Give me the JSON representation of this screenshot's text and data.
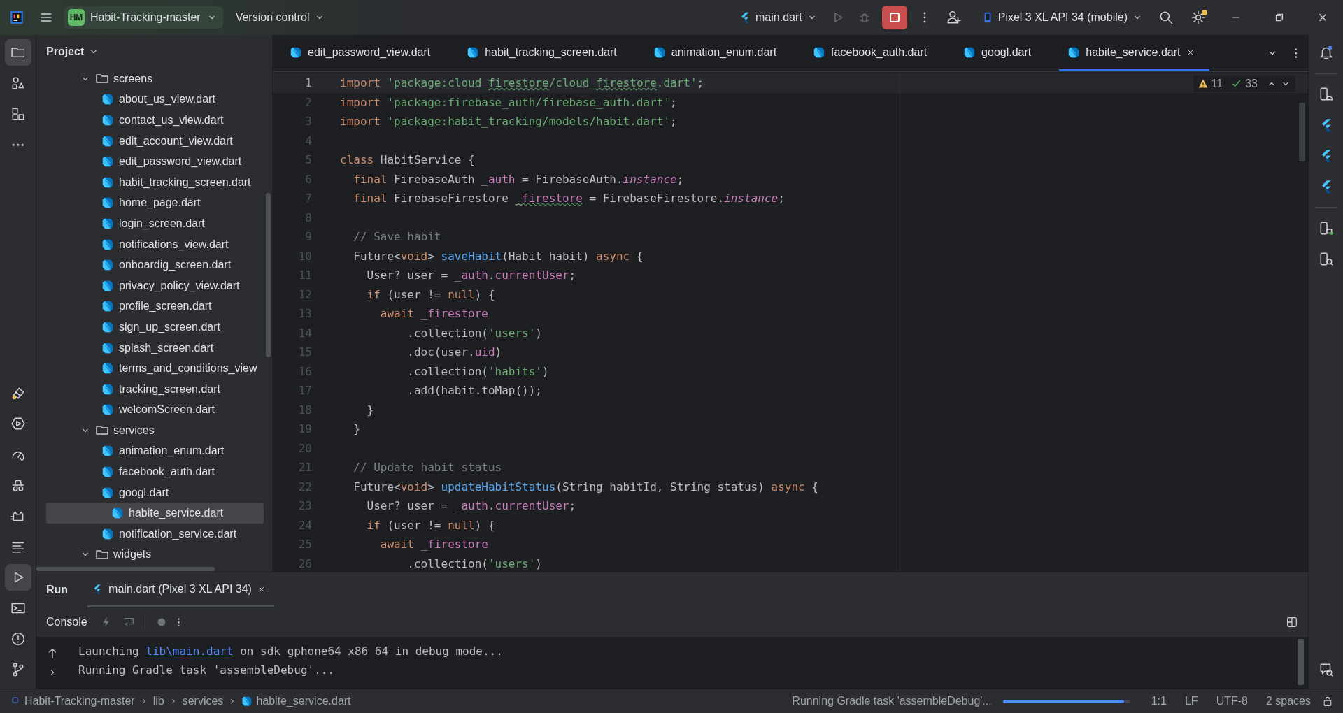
{
  "title_bar": {
    "project_badge": "HM",
    "project_name": "Habit-Tracking-master",
    "vcs_menu": "Version control",
    "run_config": "main.dart",
    "device": "Pixel 3 XL API 34 (mobile)",
    "run_enabled": false,
    "debug_enabled": false,
    "settings_notification": true
  },
  "left_toolbar": {
    "top": [
      {
        "selected": true
      },
      {
        "selected": false
      },
      {
        "selected": false
      },
      {
        "selected": false
      }
    ],
    "bottom": [
      {
        "selected": false
      },
      {
        "selected": false
      },
      {
        "selected": false
      },
      {
        "selected": false
      },
      {
        "selected": false
      },
      {
        "selected": false
      },
      {
        "selected": true
      },
      {
        "selected": false
      },
      {
        "selected": false
      },
      {
        "selected": false
      }
    ]
  },
  "project_panel": {
    "title": "Project",
    "tree": [
      {
        "name": "screens",
        "kind": "folder",
        "expanded": true,
        "selected": false,
        "children": [
          {
            "name": "about_us_view.dart",
            "kind": "file",
            "selected": false
          },
          {
            "name": "contact_us_view.dart",
            "kind": "file",
            "selected": false
          },
          {
            "name": "edit_account_view.dart",
            "kind": "file",
            "selected": false
          },
          {
            "name": "edit_password_view.dart",
            "kind": "file",
            "selected": false
          },
          {
            "name": "habit_tracking_screen.dart",
            "kind": "file",
            "selected": false
          },
          {
            "name": "home_page.dart",
            "kind": "file",
            "selected": false
          },
          {
            "name": "login_screen.dart",
            "kind": "file",
            "selected": false
          },
          {
            "name": "notifications_view.dart",
            "kind": "file",
            "selected": false
          },
          {
            "name": "onboardig_screen.dart",
            "kind": "file",
            "selected": false
          },
          {
            "name": "privacy_policy_view.dart",
            "kind": "file",
            "selected": false
          },
          {
            "name": "profile_screen.dart",
            "kind": "file",
            "selected": false
          },
          {
            "name": "sign_up_screen.dart",
            "kind": "file",
            "selected": false
          },
          {
            "name": "splash_screen.dart",
            "kind": "file",
            "selected": false
          },
          {
            "name": "terms_and_conditions_view",
            "kind": "file",
            "selected": false
          },
          {
            "name": "tracking_screen.dart",
            "kind": "file",
            "selected": false
          },
          {
            "name": "welcomScreen.dart",
            "kind": "file",
            "selected": false
          }
        ]
      },
      {
        "name": "services",
        "kind": "folder",
        "expanded": true,
        "selected": false,
        "children": [
          {
            "name": "animation_enum.dart",
            "kind": "file",
            "selected": false
          },
          {
            "name": "facebook_auth.dart",
            "kind": "file",
            "selected": false
          },
          {
            "name": "googl.dart",
            "kind": "file",
            "selected": false
          },
          {
            "name": "habite_service.dart",
            "kind": "file",
            "selected": true
          },
          {
            "name": "notification_service.dart",
            "kind": "file",
            "selected": false
          }
        ]
      },
      {
        "name": "widgets",
        "kind": "folder",
        "expanded": true,
        "selected": false
      }
    ]
  },
  "editor_tabs": [
    {
      "label": "edit_password_view.dart",
      "selected": false
    },
    {
      "label": "habit_tracking_screen.dart",
      "selected": false
    },
    {
      "label": "animation_enum.dart",
      "selected": false
    },
    {
      "label": "facebook_auth.dart",
      "selected": false
    },
    {
      "label": "googl.dart",
      "selected": false
    },
    {
      "label": "habite_service.dart",
      "selected": true
    }
  ],
  "inspections": {
    "warnings": "11",
    "passed": "33"
  },
  "code_lines": [
    {
      "number": "1",
      "current": true,
      "tokens": [
        {
          "text": "import ",
          "kind": "keyword"
        },
        {
          "text": "'package:cloud_",
          "kind": "string"
        },
        {
          "text": "firestore",
          "kind": "string_typo"
        },
        {
          "text": "/cloud_",
          "kind": "string"
        },
        {
          "text": "firestore",
          "kind": "string_typo"
        },
        {
          "text": ".dart'",
          "kind": "string"
        },
        {
          "text": ";",
          "kind": "plain"
        }
      ]
    },
    {
      "number": "2",
      "current": false,
      "tokens": [
        {
          "text": "import ",
          "kind": "keyword"
        },
        {
          "text": "'package:firebase_auth/firebase_auth.dart'",
          "kind": "string"
        },
        {
          "text": ";",
          "kind": "plain"
        }
      ]
    },
    {
      "number": "3",
      "current": false,
      "tokens": [
        {
          "text": "import ",
          "kind": "keyword"
        },
        {
          "text": "'package:habit_tracking/models/habit.dart'",
          "kind": "string"
        },
        {
          "text": ";",
          "kind": "plain"
        }
      ]
    },
    {
      "number": "4",
      "current": false
    },
    {
      "number": "5",
      "current": false,
      "tokens": [
        {
          "text": "class",
          "kind": "keyword"
        },
        {
          "text": " HabitService {",
          "kind": "plain"
        }
      ]
    },
    {
      "number": "6",
      "current": false,
      "tokens": [
        {
          "text": "  final",
          "kind": "keyword"
        },
        {
          "text": " FirebaseAuth ",
          "kind": "plain"
        },
        {
          "text": "_auth",
          "kind": "field"
        },
        {
          "text": " = FirebaseAuth.",
          "kind": "plain"
        },
        {
          "text": "instance",
          "kind": "static"
        },
        {
          "text": ";",
          "kind": "plain"
        }
      ]
    },
    {
      "number": "7",
      "current": false,
      "tokens": [
        {
          "text": "  final",
          "kind": "keyword"
        },
        {
          "text": " FirebaseFirestore ",
          "kind": "plain"
        },
        {
          "text": "_firestore",
          "kind": "field_typo"
        },
        {
          "text": " = FirebaseFirestore.",
          "kind": "plain"
        },
        {
          "text": "instance",
          "kind": "static"
        },
        {
          "text": ";",
          "kind": "plain"
        }
      ]
    },
    {
      "number": "8",
      "current": false
    },
    {
      "number": "9",
      "current": false,
      "tokens": [
        {
          "text": "  // Save habit",
          "kind": "comment"
        }
      ]
    },
    {
      "number": "10",
      "current": false,
      "tokens": [
        {
          "text": "  Future<",
          "kind": "plain"
        },
        {
          "text": "void",
          "kind": "keyword"
        },
        {
          "text": "> ",
          "kind": "plain"
        },
        {
          "text": "saveHabit",
          "kind": "function"
        },
        {
          "text": "(Habit habit) ",
          "kind": "plain"
        },
        {
          "text": "async",
          "kind": "keyword"
        },
        {
          "text": " {",
          "kind": "plain"
        }
      ]
    },
    {
      "number": "11",
      "current": false,
      "tokens": [
        {
          "text": "    User? user = ",
          "kind": "plain"
        },
        {
          "text": "_auth",
          "kind": "field"
        },
        {
          "text": ".",
          "kind": "plain"
        },
        {
          "text": "currentUser",
          "kind": "field"
        },
        {
          "text": ";",
          "kind": "plain"
        }
      ]
    },
    {
      "number": "12",
      "current": false,
      "tokens": [
        {
          "text": "    if",
          "kind": "keyword"
        },
        {
          "text": " (user != ",
          "kind": "plain"
        },
        {
          "text": "null",
          "kind": "keyword"
        },
        {
          "text": ") {",
          "kind": "plain"
        }
      ]
    },
    {
      "number": "13",
      "current": false,
      "tokens": [
        {
          "text": "      await ",
          "kind": "keyword"
        },
        {
          "text": "_firestore",
          "kind": "field"
        }
      ]
    },
    {
      "number": "14",
      "current": false,
      "tokens": [
        {
          "text": "          .collection(",
          "kind": "plain"
        },
        {
          "text": "'users'",
          "kind": "string"
        },
        {
          "text": ")",
          "kind": "plain"
        }
      ]
    },
    {
      "number": "15",
      "current": false,
      "tokens": [
        {
          "text": "          .doc(user.",
          "kind": "plain"
        },
        {
          "text": "uid",
          "kind": "field"
        },
        {
          "text": ")",
          "kind": "plain"
        }
      ]
    },
    {
      "number": "16",
      "current": false,
      "tokens": [
        {
          "text": "          .collection(",
          "kind": "plain"
        },
        {
          "text": "'habits'",
          "kind": "string"
        },
        {
          "text": ")",
          "kind": "plain"
        }
      ]
    },
    {
      "number": "17",
      "current": false,
      "tokens": [
        {
          "text": "          .add(habit.toMap());",
          "kind": "plain"
        }
      ]
    },
    {
      "number": "18",
      "current": false,
      "tokens": [
        {
          "text": "    }",
          "kind": "plain"
        }
      ]
    },
    {
      "number": "19",
      "current": false,
      "tokens": [
        {
          "text": "  }",
          "kind": "plain"
        }
      ]
    },
    {
      "number": "20",
      "current": false
    },
    {
      "number": "21",
      "current": false,
      "tokens": [
        {
          "text": "  // Update habit status",
          "kind": "comment"
        }
      ]
    },
    {
      "number": "22",
      "current": false,
      "tokens": [
        {
          "text": "  Future<",
          "kind": "plain"
        },
        {
          "text": "void",
          "kind": "keyword"
        },
        {
          "text": "> ",
          "kind": "plain"
        },
        {
          "text": "updateHabitStatus",
          "kind": "function"
        },
        {
          "text": "(String habitId, String status) ",
          "kind": "plain"
        },
        {
          "text": "async",
          "kind": "keyword"
        },
        {
          "text": " {",
          "kind": "plain"
        }
      ]
    },
    {
      "number": "23",
      "current": false,
      "tokens": [
        {
          "text": "    User? user = ",
          "kind": "plain"
        },
        {
          "text": "_auth",
          "kind": "field"
        },
        {
          "text": ".",
          "kind": "plain"
        },
        {
          "text": "currentUser",
          "kind": "field"
        },
        {
          "text": ";",
          "kind": "plain"
        }
      ]
    },
    {
      "number": "24",
      "current": false,
      "tokens": [
        {
          "text": "    if",
          "kind": "keyword"
        },
        {
          "text": " (user != ",
          "kind": "plain"
        },
        {
          "text": "null",
          "kind": "keyword"
        },
        {
          "text": ") {",
          "kind": "plain"
        }
      ]
    },
    {
      "number": "25",
      "current": false,
      "tokens": [
        {
          "text": "      await ",
          "kind": "keyword"
        },
        {
          "text": "_firestore",
          "kind": "field"
        }
      ]
    },
    {
      "number": "26",
      "current": false,
      "tokens": [
        {
          "text": "          .collection(",
          "kind": "plain"
        },
        {
          "text": "'users'",
          "kind": "string"
        },
        {
          "text": ")",
          "kind": "plain"
        }
      ]
    }
  ],
  "run_panel": {
    "title": "Run",
    "tabs": [
      {
        "label": "main.dart (Pixel 3 XL API 34)",
        "selected": true
      }
    ],
    "console_label": "Console",
    "console_lines": [
      [
        {
          "text": "Launching ",
          "kind": "plain"
        },
        {
          "text": "lib\\main.dart",
          "kind": "link"
        },
        {
          "text": " on sdk gphone64 x86 64 in debug mode...",
          "kind": "plain"
        }
      ],
      [
        {
          "text": "Running Gradle task 'assembleDebug'...",
          "kind": "plain"
        }
      ]
    ]
  },
  "status_bar": {
    "breadcrumbs": [
      "Habit-Tracking-master",
      "lib",
      "services",
      "habite_service.dart"
    ],
    "task": "Running Gradle task 'assembleDebug'...",
    "level": 0.95,
    "position": "1:1",
    "line_separator": "LF",
    "encoding": "UTF-8",
    "indent": "2 spaces"
  }
}
